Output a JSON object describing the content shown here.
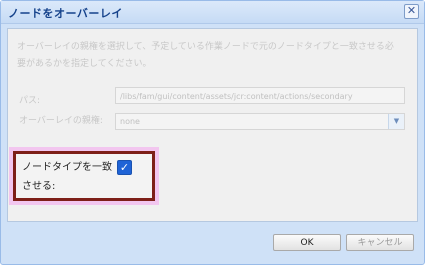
{
  "dialog": {
    "title": "ノードをオーバーレイ",
    "close_symbol": "✕"
  },
  "description": "オーバーレイの親権を選択して、予定している作業ノードで元のノードタイプと一致させる必要があるかを指定してください。",
  "form": {
    "path_label": "パス:",
    "path_value": "/libs/fam/gui/content/assets/jcr:content/actions/secondary",
    "type_label": "オーバーレイの親権:",
    "type_value": "none",
    "match_label": "ノードタイプを一致させる:",
    "match_checked": true,
    "checkmark": "✓",
    "dropdown_symbol": "▼"
  },
  "buttons": {
    "ok": "OK",
    "cancel": "キャンセル"
  }
}
